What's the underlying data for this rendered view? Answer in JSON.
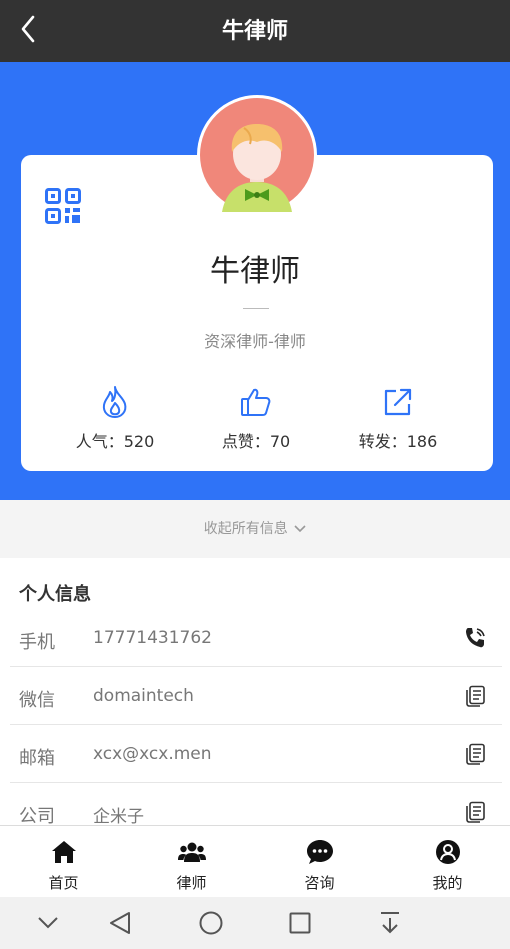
{
  "header": {
    "title": "牛律师"
  },
  "profile": {
    "name": "牛律师",
    "subtitle": "资深律师-律师"
  },
  "stats": [
    {
      "label": "人气：520",
      "icon": "fire-icon"
    },
    {
      "label": "点赞：70",
      "icon": "thumbs-up-icon"
    },
    {
      "label": "转发：186",
      "icon": "share-icon"
    }
  ],
  "collapse_label": "收起所有信息",
  "info": {
    "heading": "个人信息",
    "rows": [
      {
        "label": "手机",
        "value": "17771431762",
        "action_icon": "phone-icon"
      },
      {
        "label": "微信",
        "value": "domaintech",
        "action_icon": "copy-icon"
      },
      {
        "label": "邮箱",
        "value": "xcx@xcx.men",
        "action_icon": "copy-icon"
      },
      {
        "label": "公司",
        "value": "企米子",
        "action_icon": "copy-icon"
      }
    ]
  },
  "tabs": [
    {
      "label": "首页",
      "icon": "home-icon"
    },
    {
      "label": "律师",
      "icon": "people-icon"
    },
    {
      "label": "咨询",
      "icon": "chat-icon"
    },
    {
      "label": "我的",
      "icon": "user-icon"
    }
  ],
  "colors": {
    "header": "#333333",
    "brand_blue": "#2f73f7",
    "icon_blue": "#2f73f7"
  }
}
